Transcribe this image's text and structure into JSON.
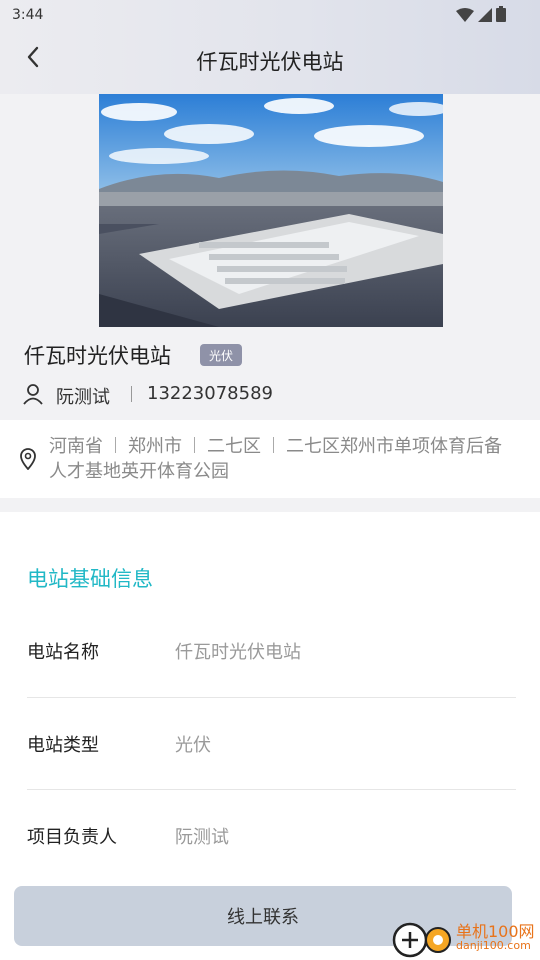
{
  "status_bar": {
    "time": "3:44"
  },
  "header": {
    "title": "仟瓦时光伏电站",
    "back_icon": "chevron-left-icon"
  },
  "station": {
    "name": "仟瓦时光伏电站",
    "tag": "光伏",
    "contact_name": "阮测试",
    "contact_phone": "13223078589"
  },
  "address": {
    "province": "河南省",
    "city": "郑州市",
    "district": "二七区",
    "detail": "二七区郑州市单项体育后备人才基地英开体育公园"
  },
  "basic_info": {
    "title": "电站基础信息",
    "rows": [
      {
        "label": "电站名称",
        "value": "仟瓦时光伏电站"
      },
      {
        "label": "电站类型",
        "value": "光伏"
      },
      {
        "label": "项目负责人",
        "value": "阮测试"
      }
    ]
  },
  "footer": {
    "contact_button": "线上联系"
  },
  "watermark": {
    "name": "单机100网",
    "url": "danji100.com"
  },
  "colors": {
    "accent": "#21b8c6",
    "tag_bg": "#8f92a8",
    "button_bg": "#c8d0dc"
  }
}
